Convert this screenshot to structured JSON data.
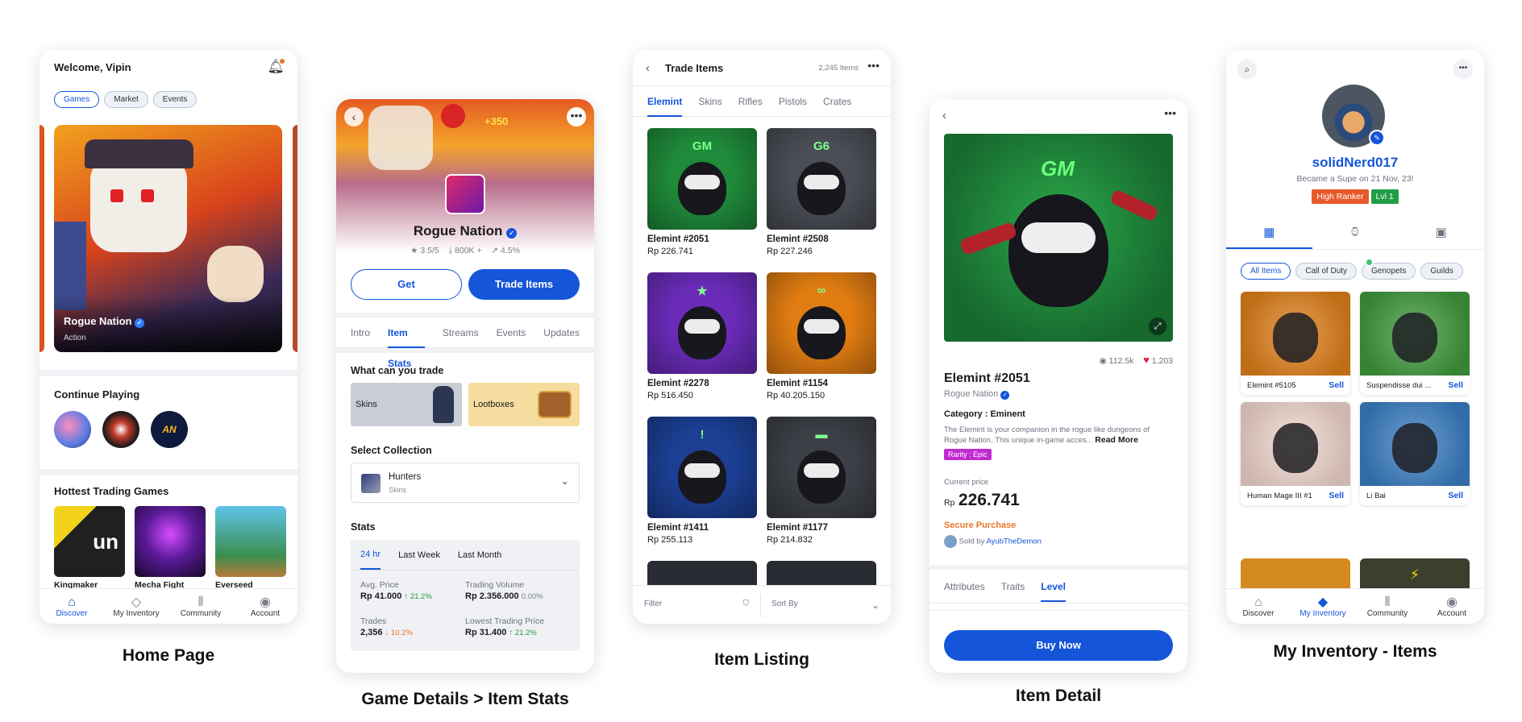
{
  "captions": {
    "home": "Home Page",
    "game": "Game Details > Item Stats",
    "listing": "Item Listing",
    "detail": "Item Detail",
    "inventory": "My Inventory - Items"
  },
  "home": {
    "welcome": "Welcome, Vipin",
    "chips": [
      "Games",
      "Market",
      "Events"
    ],
    "hero_title": "Rogue Nation",
    "hero_genre": "Action",
    "continue_title": "Continue Playing",
    "continue_badge": "AN",
    "hottest_title": "Hottest Trading Games",
    "hottest": [
      "Kingmaker",
      "Mecha Fight",
      "Everseed"
    ],
    "hottest_logo": "un"
  },
  "nav": [
    {
      "label": "Discover",
      "icon": "home-icon"
    },
    {
      "label": "My Inventory",
      "icon": "inventory-icon"
    },
    {
      "label": "Community",
      "icon": "community-icon"
    },
    {
      "label": "Account",
      "icon": "account-icon"
    }
  ],
  "game": {
    "banner_badge": "+350",
    "title": "Rogue Nation",
    "rating": "3.5/5",
    "downloads": "800K +",
    "growth": "4.5%",
    "get_label": "Get",
    "trade_label": "Trade Items",
    "tabs": [
      "Intro",
      "Item Stats",
      "Streams",
      "Events",
      "Updates"
    ],
    "trade_title": "What can you trade",
    "trade_types": [
      "Skins",
      "Lootboxes"
    ],
    "collection_title": "Select Collection",
    "collection_name": "Hunters",
    "collection_sub": "Skins",
    "stats_title": "Stats",
    "stats_tabs": [
      "24 hr",
      "Last Week",
      "Last Month"
    ],
    "avg_label": "Avg. Price",
    "avg_value": "Rp 41.000",
    "avg_change": "21.2%",
    "vol_label": "Trading Volume",
    "vol_value": "Rp 2.356.000",
    "vol_change": "0.00%",
    "trades_label": "Trades",
    "trades_value": "2,356",
    "trades_change": "10.2%",
    "low_label": "Lowest Trading Price",
    "low_value": "Rp 31.400",
    "low_change": "21.2%"
  },
  "listing": {
    "title": "Trade Items",
    "count": "2,245 Items",
    "tabs": [
      "Elemint",
      "Skins",
      "Rifles",
      "Pistols",
      "Crates"
    ],
    "items": [
      {
        "name": "Elemint #2051",
        "price": "Rp 226.741",
        "bg": "#1f8a3a",
        "mark": "GM"
      },
      {
        "name": "Elemint #2508",
        "price": "Rp 227.246",
        "bg": "#4a4d55",
        "mark": "G6"
      },
      {
        "name": "Elemint #2278",
        "price": "Rp 516.450",
        "bg": "#6a2bb8",
        "mark": "★"
      },
      {
        "name": "Elemint #1154",
        "price": "Rp 40.205.150",
        "bg": "#e07c12",
        "mark": "∞"
      },
      {
        "name": "Elemint #1411",
        "price": "Rp 255.113",
        "bg": "#1c3f94",
        "mark": "!"
      },
      {
        "name": "Elemint #1177",
        "price": "Rp 214.832",
        "bg": "#3c3f46",
        "mark": "▬"
      }
    ],
    "filter": "Filter",
    "sort": "Sort By"
  },
  "detail": {
    "mark": "GM",
    "views": "112.5k",
    "likes": "1,203",
    "name": "Elemint #2051",
    "game": "Rogue Nation",
    "category": "Category : Eminent",
    "desc": "The Elemint is your companion in the rogue like dungeons of Rogue Nation. This unique in-game acces...",
    "read_more": "Read More",
    "rarity": "Rarity : Epic",
    "price_label": "Current price",
    "currency": "Rp",
    "price": "226.741",
    "secure": "Secure Purchase",
    "sold_by": "Sold by",
    "seller": "AyubTheDemon",
    "tabs": [
      "Attributes",
      "Traits",
      "Level"
    ],
    "buy": "Buy Now"
  },
  "inventory": {
    "username": "solidNerd017",
    "since": "Became a Supe on 21 Nov, 23!",
    "badge1": "High Ranker",
    "badge2": "Lvl 1",
    "filters": [
      "All Items",
      "Call of Duty",
      "Genopets",
      "Guilds"
    ],
    "items": [
      {
        "name": "Elemint #5105",
        "action": "Sell",
        "bg": "#e0801a"
      },
      {
        "name": "Suspendisse dui ...",
        "action": "Sell",
        "bg": "#3f9a3c"
      },
      {
        "name": "Human Mage III #1",
        "action": "Sell",
        "bg": "#f2d7cf"
      },
      {
        "name": "Li Bai",
        "action": "Sell",
        "bg": "#3a7fc4"
      }
    ]
  },
  "colors": {
    "primary": "#1455d9",
    "orange": "#e8762a",
    "green": "#1f9e45",
    "purple": "#c02ad1"
  }
}
